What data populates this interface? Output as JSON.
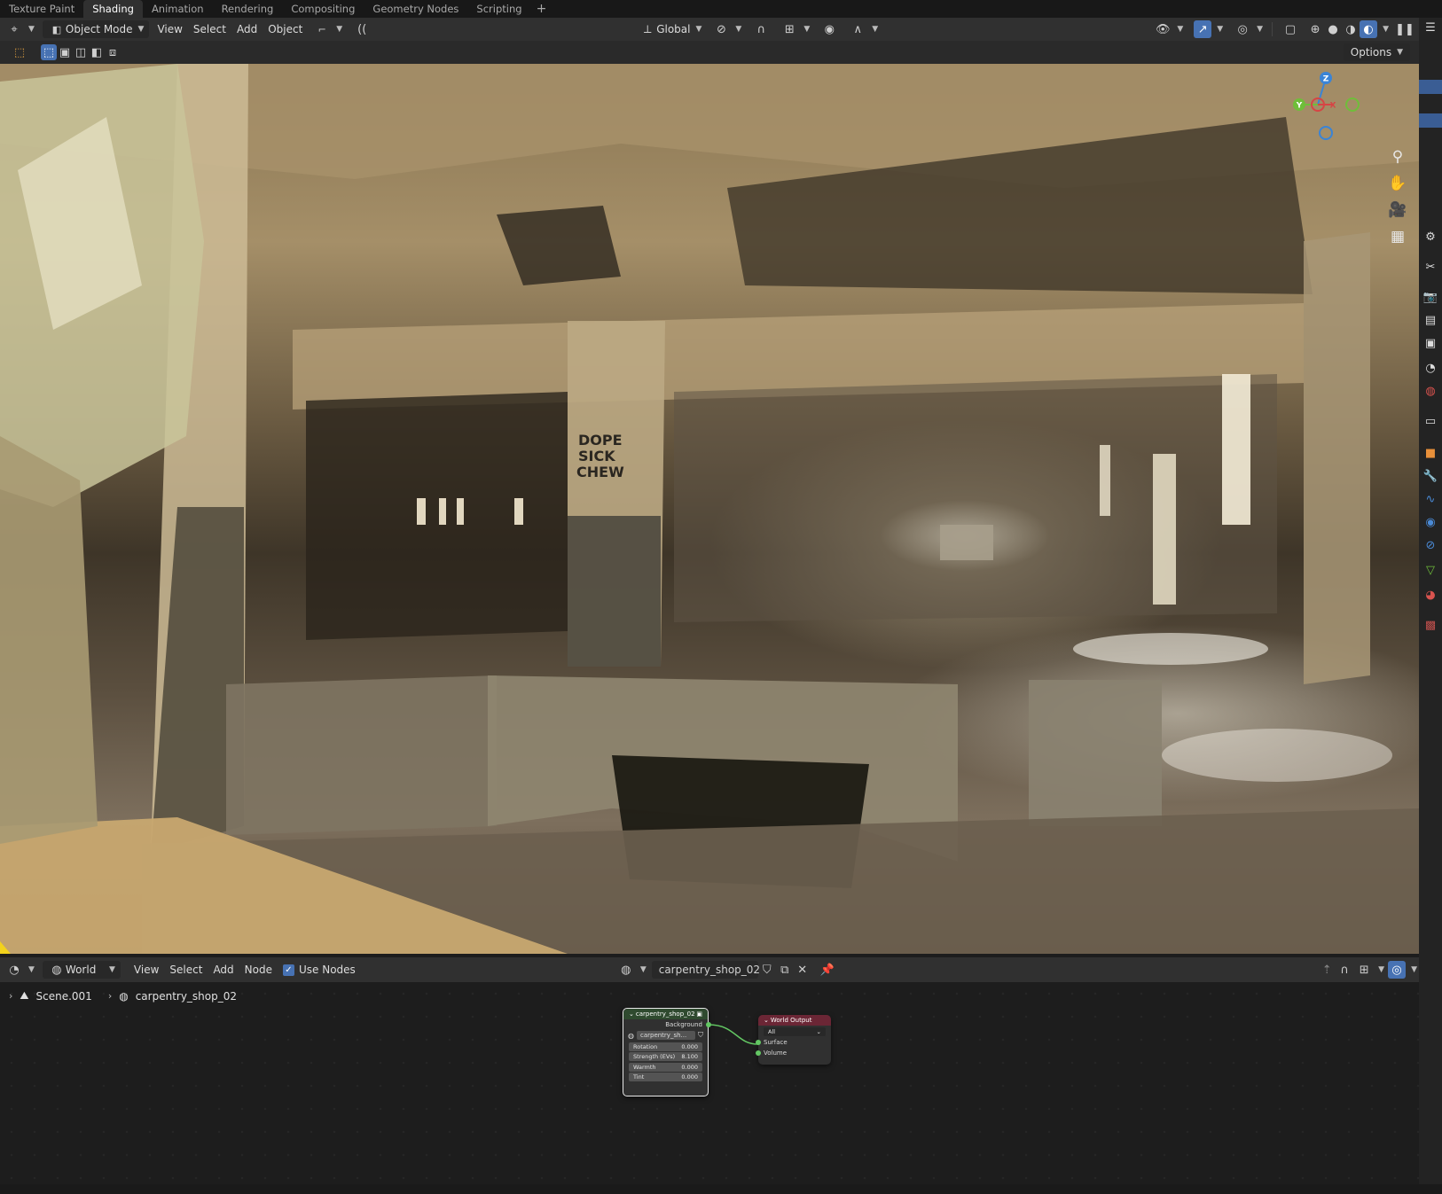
{
  "workspace_tabs": [
    "Texture Paint",
    "Shading",
    "Animation",
    "Rendering",
    "Compositing",
    "Geometry Nodes",
    "Scripting"
  ],
  "active_workspace": "Shading",
  "viewport_header": {
    "mode": "Object Mode",
    "menus": [
      "View",
      "Select",
      "Add",
      "Object"
    ],
    "transform_orientation": "Global"
  },
  "tool_row": {
    "options_label": "Options"
  },
  "scene_graffiti": "DOPE SICK CHEW",
  "gizmo_axes": {
    "x": "X",
    "y": "Y",
    "z": "Z"
  },
  "node_editor_header": {
    "shader_type": "World",
    "menus": [
      "View",
      "Select",
      "Add",
      "Node"
    ],
    "use_nodes_label": "Use Nodes",
    "use_nodes_checked": true,
    "world_name": "carpentry_shop_02"
  },
  "breadcrumb": {
    "scene": "Scene.001",
    "world": "carpentry_shop_02"
  },
  "nodes": {
    "environment": {
      "title": "carpentry_shop_02",
      "output_label": "Background",
      "image_name": "carpentry_sh...",
      "fields": [
        {
          "label": "Rotation",
          "value": "0.000"
        },
        {
          "label": "Strength (EVs)",
          "value": "8.100"
        },
        {
          "label": "Warmth",
          "value": "0.000"
        },
        {
          "label": "Tint",
          "value": "0.000"
        }
      ]
    },
    "world_output": {
      "title": "World Output",
      "target": "All",
      "inputs": [
        "Surface",
        "Volume"
      ]
    }
  },
  "colors": {
    "accent_blue": "#4772b3",
    "env_node_header": "#2f4a2f",
    "world_output_header": "#6b2635",
    "shader_socket": "#63c763",
    "gizmo_x": "#d64545",
    "gizmo_y": "#6fbe3a",
    "gizmo_z": "#3a84d6"
  }
}
